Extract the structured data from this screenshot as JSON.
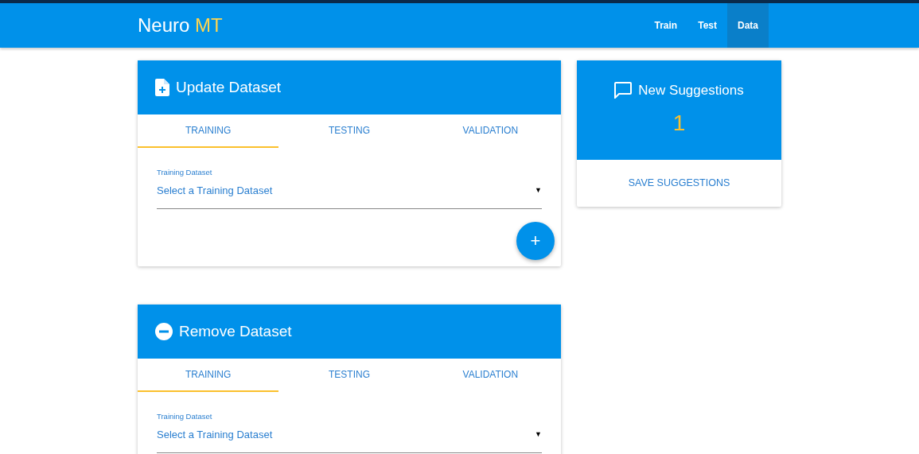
{
  "navbar": {
    "brand": "Neuro",
    "brand_accent": "MT",
    "links": [
      {
        "label": "Train",
        "selected": false
      },
      {
        "label": "Test",
        "selected": false
      },
      {
        "label": "Data",
        "selected": true
      }
    ]
  },
  "dataset_cards": [
    {
      "kind": "add",
      "title": "Update Dataset",
      "tabs": [
        {
          "label": "TRAINING",
          "selected": true
        },
        {
          "label": "TESTING",
          "selected": false
        },
        {
          "label": "VALIDATION",
          "selected": false
        }
      ],
      "field": {
        "label": "Training Dataset",
        "placeholder": "Select a Training Dataset",
        "caret": "▼"
      },
      "fab": "+"
    },
    {
      "kind": "remove",
      "title": "Remove Dataset",
      "tabs": [
        {
          "label": "TRAINING",
          "selected": true
        },
        {
          "label": "TESTING",
          "selected": false
        },
        {
          "label": "VALIDATION",
          "selected": false
        }
      ],
      "field": {
        "label": "Training Dataset",
        "placeholder": "Select a Training Dataset",
        "caret": "▼"
      }
    }
  ],
  "suggestions": {
    "title": "New Suggestions",
    "count": "1",
    "action": "SAVE SUGGESTIONS"
  }
}
